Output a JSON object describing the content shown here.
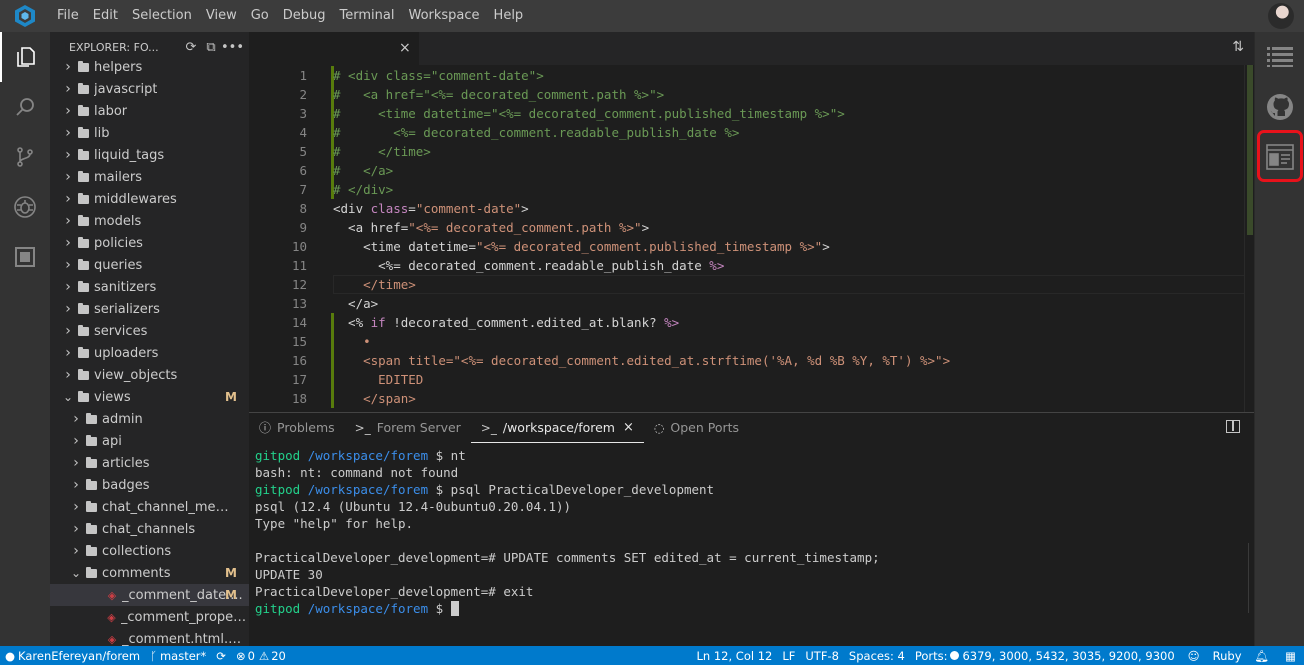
{
  "menubar": {
    "items": [
      "File",
      "Edit",
      "Selection",
      "View",
      "Go",
      "Debug",
      "Terminal",
      "Workspace",
      "Help"
    ]
  },
  "sidebar": {
    "title": "EXPLORER: FO...",
    "tree": [
      {
        "label": "helpers",
        "indent": 0,
        "open": false
      },
      {
        "label": "javascript",
        "indent": 0,
        "open": false
      },
      {
        "label": "labor",
        "indent": 0,
        "open": false
      },
      {
        "label": "lib",
        "indent": 0,
        "open": false
      },
      {
        "label": "liquid_tags",
        "indent": 0,
        "open": false
      },
      {
        "label": "mailers",
        "indent": 0,
        "open": false
      },
      {
        "label": "middlewares",
        "indent": 0,
        "open": false
      },
      {
        "label": "models",
        "indent": 0,
        "open": false
      },
      {
        "label": "policies",
        "indent": 0,
        "open": false
      },
      {
        "label": "queries",
        "indent": 0,
        "open": false
      },
      {
        "label": "sanitizers",
        "indent": 0,
        "open": false
      },
      {
        "label": "serializers",
        "indent": 0,
        "open": false
      },
      {
        "label": "services",
        "indent": 0,
        "open": false
      },
      {
        "label": "uploaders",
        "indent": 0,
        "open": false
      },
      {
        "label": "view_objects",
        "indent": 0,
        "open": false
      },
      {
        "label": "views",
        "indent": 0,
        "open": true,
        "badge": "M"
      },
      {
        "label": "admin",
        "indent": 1,
        "open": false
      },
      {
        "label": "api",
        "indent": 1,
        "open": false
      },
      {
        "label": "articles",
        "indent": 1,
        "open": false
      },
      {
        "label": "badges",
        "indent": 1,
        "open": false
      },
      {
        "label": "chat_channel_memb...",
        "indent": 1,
        "open": false
      },
      {
        "label": "chat_channels",
        "indent": 1,
        "open": false
      },
      {
        "label": "collections",
        "indent": 1,
        "open": false
      },
      {
        "label": "comments",
        "indent": 1,
        "open": true,
        "badge": "M"
      },
      {
        "label": "_comment_date....",
        "indent": 2,
        "file": true,
        "badge": "M",
        "selected": true
      },
      {
        "label": "_comment_proper.h...",
        "indent": 2,
        "file": true
      },
      {
        "label": "_comment.html.erb",
        "indent": 2,
        "file": true
      }
    ]
  },
  "editor": {
    "tab_close": "×",
    "lines": [
      {
        "n": "1",
        "mark": true,
        "spans": [
          [
            "c-comment",
            "# <div class=\"comment-date\">"
          ]
        ]
      },
      {
        "n": "2",
        "mark": true,
        "spans": [
          [
            "c-comment",
            "#   <a href=\"<%= decorated_comment.path %>\">"
          ]
        ]
      },
      {
        "n": "3",
        "mark": true,
        "spans": [
          [
            "c-comment",
            "#     <time datetime=\"<%= decorated_comment.published_timestamp %>\">"
          ]
        ]
      },
      {
        "n": "4",
        "mark": true,
        "spans": [
          [
            "c-comment",
            "#       <%= decorated_comment.readable_publish_date %>"
          ]
        ]
      },
      {
        "n": "5",
        "mark": true,
        "spans": [
          [
            "c-comment",
            "#     </time>"
          ]
        ]
      },
      {
        "n": "6",
        "mark": true,
        "spans": [
          [
            "c-comment",
            "#   </a>"
          ]
        ]
      },
      {
        "n": "7",
        "mark": true,
        "spans": [
          [
            "c-comment",
            "# </div>"
          ]
        ]
      },
      {
        "n": "8",
        "mark": false,
        "spans": [
          [
            "c-plain",
            "<div "
          ],
          [
            "c-kw",
            "class"
          ],
          [
            "c-plain",
            "="
          ],
          [
            "c-str",
            "\"comment-date\""
          ],
          [
            "c-plain",
            ">"
          ]
        ]
      },
      {
        "n": "9",
        "mark": false,
        "spans": [
          [
            "c-plain",
            "  <a href="
          ],
          [
            "c-str",
            "\"<%= decorated_comment.path %>\""
          ],
          [
            "c-plain",
            ">"
          ]
        ]
      },
      {
        "n": "10",
        "mark": false,
        "spans": [
          [
            "c-plain",
            "    <time datetime="
          ],
          [
            "c-str",
            "\"<%= decorated_comment.published_timestamp %>\""
          ],
          [
            "c-plain",
            ">"
          ]
        ]
      },
      {
        "n": "11",
        "mark": false,
        "spans": [
          [
            "c-plain",
            "      <%= decorated_comment.readable_publish_date "
          ],
          [
            "c-kw",
            "%>"
          ]
        ]
      },
      {
        "n": "12",
        "mark": false,
        "cursor": true,
        "spans": [
          [
            "c-str",
            "    </time>"
          ]
        ]
      },
      {
        "n": "13",
        "mark": false,
        "spans": [
          [
            "c-plain",
            "  </a>"
          ]
        ]
      },
      {
        "n": "14",
        "mark": true,
        "spans": [
          [
            "c-plain",
            "  <% "
          ],
          [
            "c-kw",
            "if"
          ],
          [
            "c-plain",
            " !decorated_comment.edited_at.blank? "
          ],
          [
            "c-kw",
            "%>"
          ]
        ]
      },
      {
        "n": "15",
        "mark": true,
        "spans": [
          [
            "c-str",
            "    •"
          ]
        ]
      },
      {
        "n": "16",
        "mark": true,
        "spans": [
          [
            "c-str",
            "    <span title=\"<%= decorated_comment.edited_at.strftime('%A, %d %B %Y, %T') %>\">"
          ]
        ]
      },
      {
        "n": "17",
        "mark": true,
        "spans": [
          [
            "c-str",
            "      EDITED"
          ]
        ]
      },
      {
        "n": "18",
        "mark": true,
        "spans": [
          [
            "c-str",
            "    </span>"
          ]
        ]
      }
    ]
  },
  "panel": {
    "tabs": [
      {
        "label": "Problems",
        "icon": "ⓘ",
        "active": false
      },
      {
        "label": "Forem Server",
        "icon": ">_",
        "active": false
      },
      {
        "label": "/workspace/forem",
        "icon": ">_",
        "active": true,
        "close": "×"
      },
      {
        "label": "Open Ports",
        "icon": "◌",
        "active": false
      }
    ],
    "terminal": [
      {
        "prompt_user": "gitpod",
        "prompt_path": "/workspace/forem",
        "cmd": " $ nt"
      },
      {
        "text": "bash: nt: command not found"
      },
      {
        "prompt_user": "gitpod",
        "prompt_path": "/workspace/forem",
        "cmd": " $ psql PracticalDeveloper_development"
      },
      {
        "text": "psql (12.4 (Ubuntu 12.4-0ubuntu0.20.04.1))"
      },
      {
        "text": "Type \"help\" for help."
      },
      {
        "text": ""
      },
      {
        "text": "PracticalDeveloper_development=# UPDATE comments SET edited_at = current_timestamp;"
      },
      {
        "text": "UPDATE 30"
      },
      {
        "text": "PracticalDeveloper_development=# exit"
      },
      {
        "prompt_user": "gitpod",
        "prompt_path": "/workspace/forem",
        "cmd": " $ ",
        "cursor": true
      }
    ]
  },
  "statusbar": {
    "repo": "KarenEfereyan/forem",
    "branch": "master*",
    "errors": "0",
    "warnings": "20",
    "position": "Ln 12, Col 12",
    "eol": "LF",
    "encoding": "UTF-8",
    "spaces": "Spaces: 4",
    "ports_label": "Ports:",
    "ports": "6379, 3000, 5432, 3035, 9200, 9300",
    "language": "Ruby"
  },
  "colors": {
    "accent": "#007acc",
    "highlight_box": "#e8121b",
    "git_modified": "#e2c08d"
  }
}
